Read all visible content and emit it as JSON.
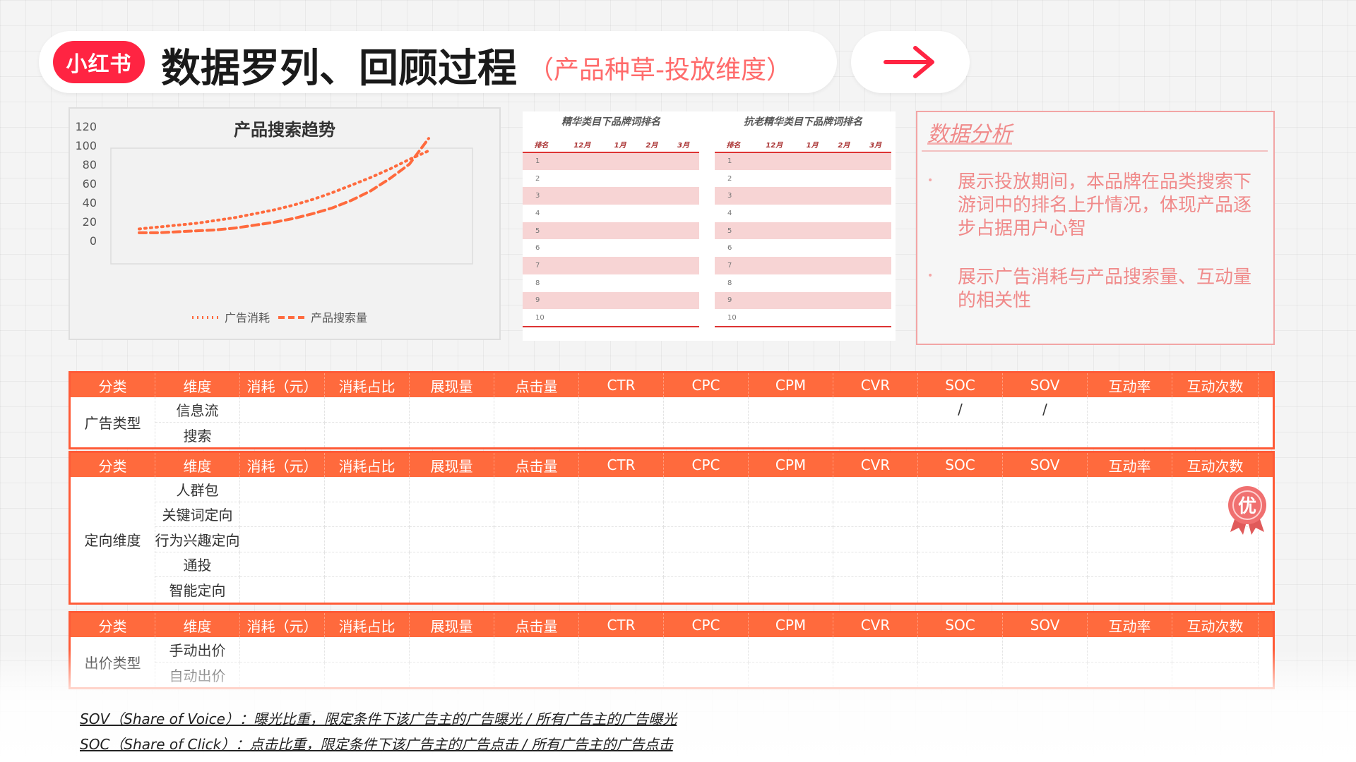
{
  "header": {
    "logo_text": "小红书",
    "title": "数据罗列、回顾过程",
    "subtitle": "（产品种草-投放维度）",
    "arrow_icon": "right-arrow-icon"
  },
  "chart_data": {
    "type": "line",
    "title": "产品搜索趋势",
    "x": [
      1,
      2,
      3,
      4,
      5,
      6,
      7,
      8,
      9,
      10,
      11,
      12,
      13,
      14,
      15,
      16
    ],
    "series": [
      {
        "name": "广告消耗",
        "style": "dotted",
        "color": "#ff6a3d",
        "values": [
          13,
          15,
          17,
          19,
          22,
          25,
          29,
          33,
          38,
          44,
          51,
          59,
          67,
          76,
          86,
          95
        ]
      },
      {
        "name": "产品搜索量",
        "style": "dashed",
        "color": "#ff6a3d",
        "values": [
          9,
          9,
          10,
          11,
          12,
          14,
          17,
          20,
          24,
          29,
          35,
          43,
          53,
          66,
          81,
          108
        ]
      }
    ],
    "ylim": [
      0,
      120
    ],
    "yticks": [
      0,
      20,
      40,
      60,
      80,
      100,
      120
    ],
    "grid": false,
    "legend": "bottom",
    "xlabel": "",
    "ylabel": ""
  },
  "rank_tables": [
    {
      "title": "精华类目下品牌词排名",
      "headers": [
        "排名",
        "12月",
        "1月",
        "2月",
        "3月"
      ],
      "rows": [
        "1",
        "2",
        "3",
        "4",
        "5",
        "6",
        "7",
        "8",
        "9",
        "10"
      ]
    },
    {
      "title": "抗老精华类目下品牌词排名",
      "headers": [
        "排名",
        "12月",
        "1月",
        "2月",
        "3月"
      ],
      "rows": [
        "1",
        "2",
        "3",
        "4",
        "5",
        "6",
        "7",
        "8",
        "9",
        "10"
      ]
    }
  ],
  "analysis": {
    "title": "数据分析",
    "bullet": "•",
    "items": [
      "展示投放期间，本品牌在品类搜索下游词中的排名上升情况，体现产品逐步占据用户心智",
      "展示广告消耗与产品搜索量、互动量的相关性"
    ]
  },
  "columns": [
    "分类",
    "维度",
    "消耗（元）",
    "消耗占比",
    "展现量",
    "点击量",
    "CTR",
    "CPC",
    "CPM",
    "CVR",
    "SOC",
    "SOV",
    "互动率",
    "互动次数"
  ],
  "tables": [
    {
      "category": "广告类型",
      "rows": [
        {
          "dim": "信息流",
          "soc": "/",
          "sov": "/"
        },
        {
          "dim": "搜索",
          "soc": "",
          "sov": ""
        }
      ]
    },
    {
      "category": "定向维度",
      "rows": [
        {
          "dim": "人群包",
          "soc": "",
          "sov": ""
        },
        {
          "dim": "关键词定向",
          "soc": "",
          "sov": ""
        },
        {
          "dim": "行为兴趣定向",
          "soc": "",
          "sov": ""
        },
        {
          "dim": "通投",
          "soc": "",
          "sov": ""
        },
        {
          "dim": "智能定向",
          "soc": "",
          "sov": ""
        }
      ]
    },
    {
      "category": "出价类型",
      "rows": [
        {
          "dim": "手动出价",
          "soc": "",
          "sov": ""
        },
        {
          "dim": "自动出价",
          "soc": "",
          "sov": ""
        }
      ]
    }
  ],
  "badge": {
    "text": "优",
    "color": "#f07070"
  },
  "footnotes": [
    "SOV（Share of Voice）：曝光比重，限定条件下该广告主的广告曝光 / 所有广告主的广告曝光",
    "SOC（Share of Click）：点击比重，限定条件下该广告主的广告点击 / 所有广告主的广告点击"
  ],
  "colors": {
    "brand": "#ff2442",
    "accent": "#ff6a3d",
    "pink": "#f08a8a"
  }
}
